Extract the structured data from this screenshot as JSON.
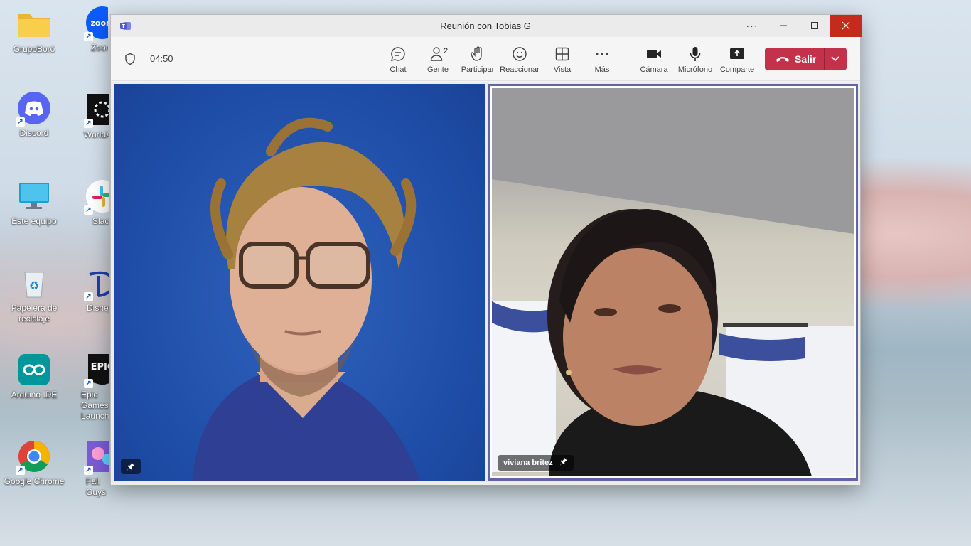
{
  "desktop": {
    "icons": [
      {
        "label": "GrupoBoró"
      },
      {
        "label": "Zoom"
      },
      {
        "label": "Discord"
      },
      {
        "label": "WorldA"
      },
      {
        "label": "Este equipo"
      },
      {
        "label": "Slack"
      },
      {
        "label": "Papelera de reciclaje"
      },
      {
        "label": "Disney"
      },
      {
        "label": "Arduino IDE"
      },
      {
        "label": "Epic Games Launcher"
      },
      {
        "label": "Google Chrome"
      },
      {
        "label": "Fall Guys"
      }
    ]
  },
  "window": {
    "title": "Reunión con Tobias G",
    "more_label": "···"
  },
  "toolbar": {
    "timer": "04:50",
    "chat": "Chat",
    "people": "Gente",
    "people_count": "2",
    "raise_hand": "Participar",
    "react": "Reaccionar",
    "view": "Vista",
    "more": "Más",
    "camera": "Cámara",
    "mic": "Micrófono",
    "share": "Comparte",
    "leave": "Salir"
  },
  "participants": [
    {
      "name": ""
    },
    {
      "name": "viviana britez"
    }
  ],
  "colors": {
    "leave_red": "#c4314b",
    "close_red": "#c42b1c",
    "active_speaker_border": "#6264a7"
  }
}
